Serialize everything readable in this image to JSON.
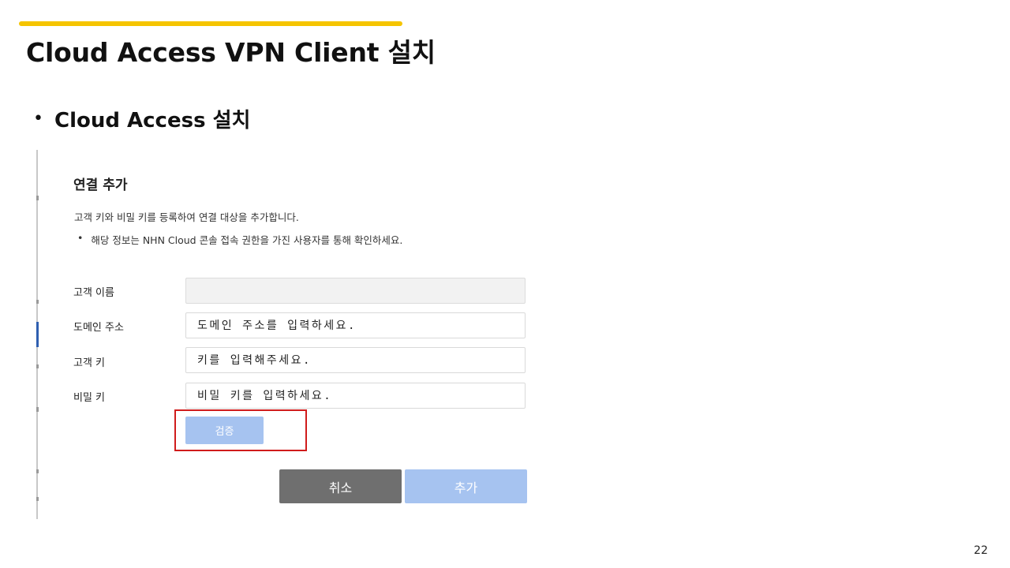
{
  "colors": {
    "accent": "#f5c400",
    "verify_button": "#a6c3f0",
    "cancel_button": "#6f6f6f",
    "add_button": "#a6c3f0",
    "highlight": "#d01c1c"
  },
  "slide": {
    "title": "Cloud Access VPN Client 설치",
    "bullet": "Cloud Access 설치",
    "page_number": "22"
  },
  "dialog": {
    "title": "연결 추가",
    "description": "고객 키와 비밀 키를 등록하여 연결 대상을 추가합니다.",
    "note_bullet": "•",
    "note": "해당 정보는 NHN Cloud 콘솔 접속 권한을 가진 사용자를 통해 확인하세요.",
    "fields": [
      {
        "label": "고객 이름",
        "value": "",
        "placeholder": ""
      },
      {
        "label": "도메인 주소",
        "value": "",
        "placeholder": "도메인 주소를 입력하세요."
      },
      {
        "label": "고객 키",
        "value": "",
        "placeholder": "키를 입력해주세요."
      },
      {
        "label": "비밀 키",
        "value": "",
        "placeholder": "비밀 키를 입력하세요."
      }
    ],
    "verify_label": "검증",
    "cancel_label": "취소",
    "add_label": "추가"
  }
}
